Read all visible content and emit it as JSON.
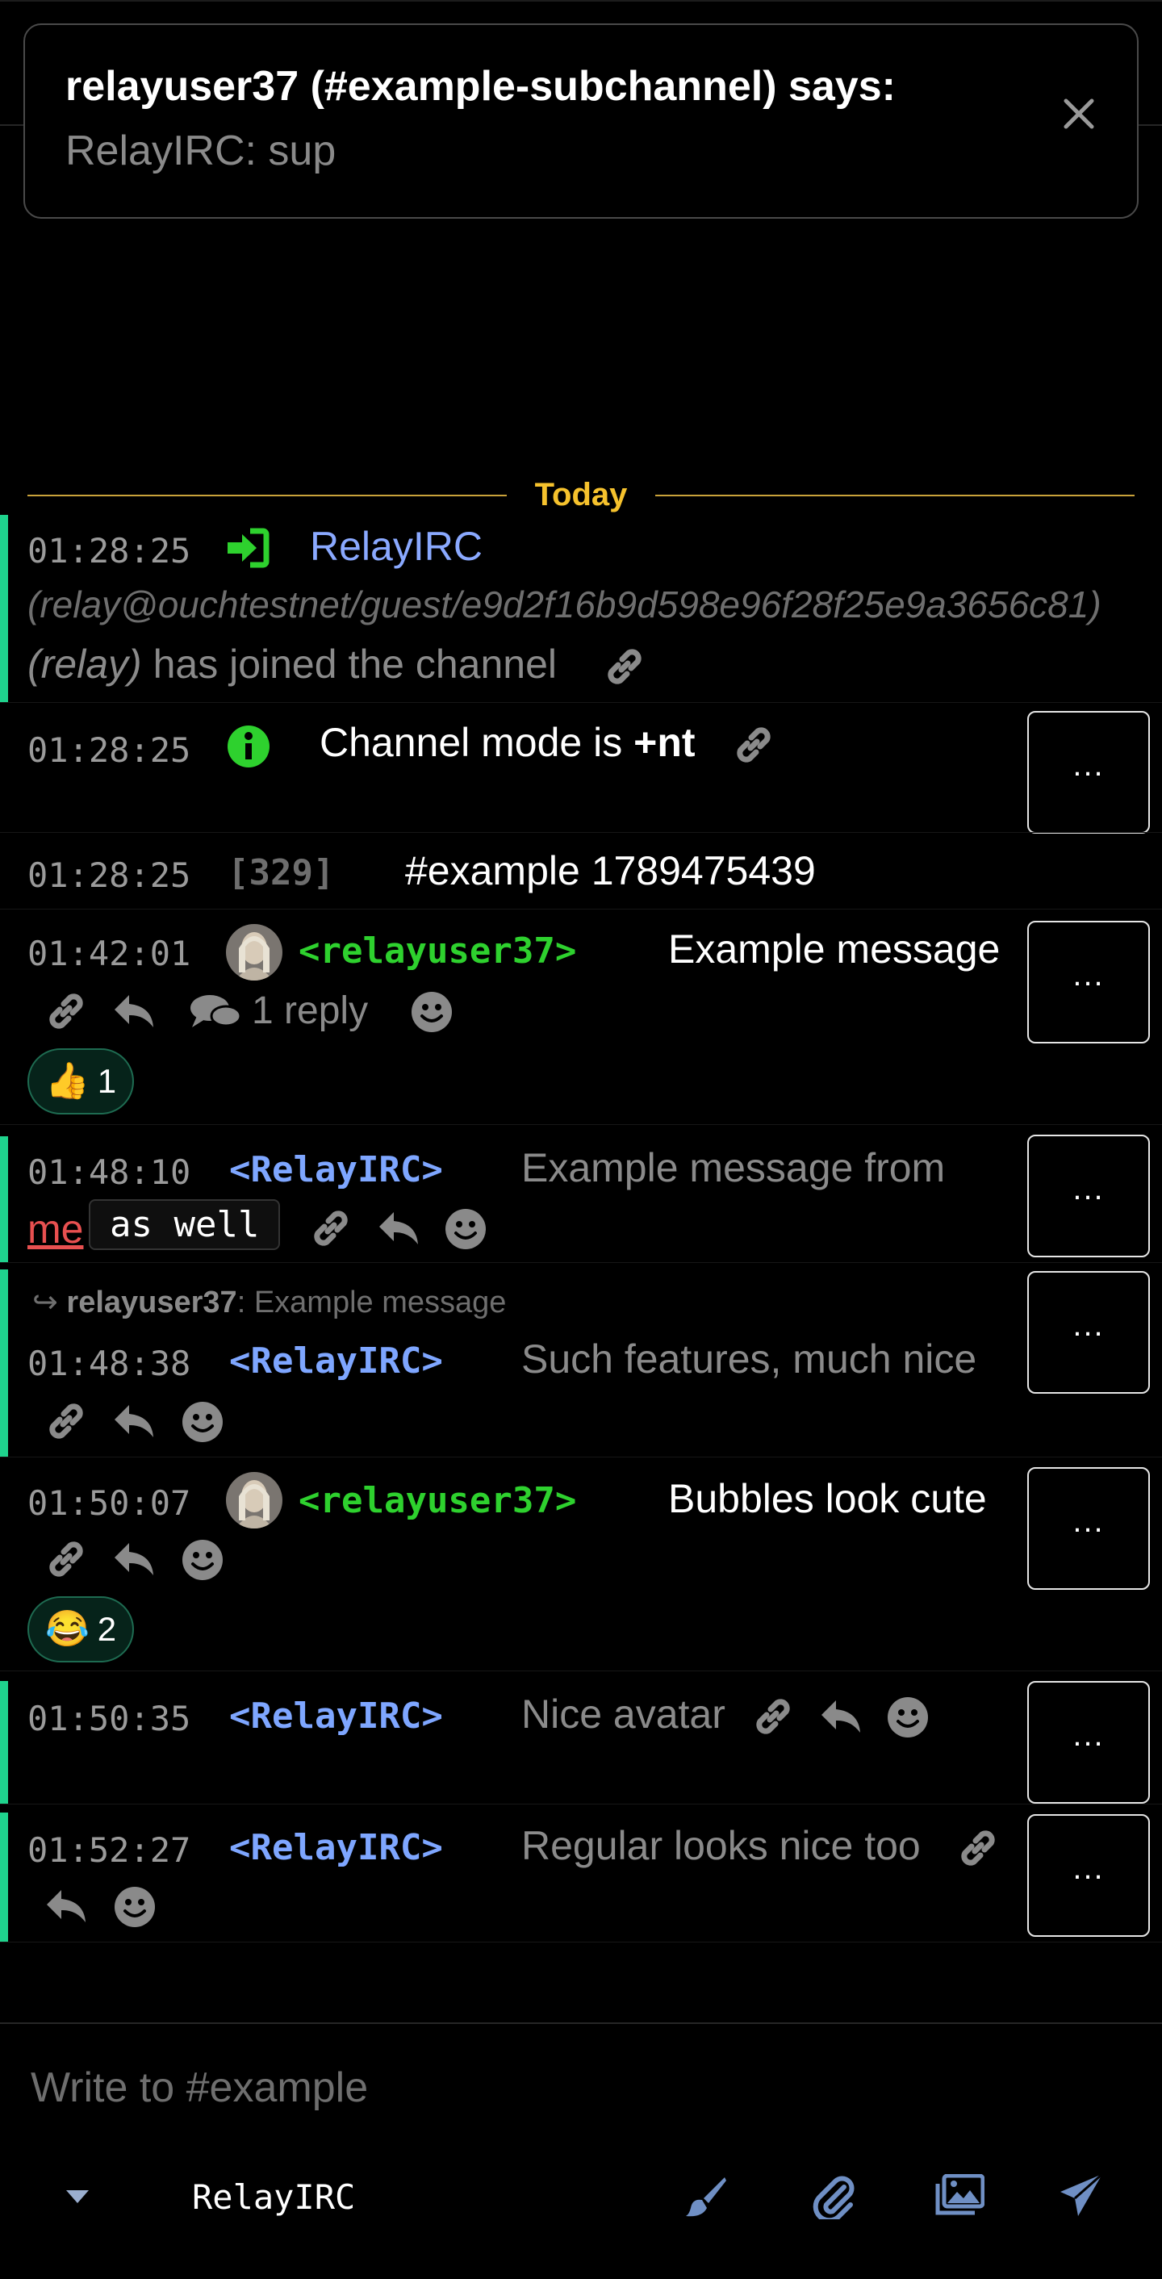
{
  "colors": {
    "background": "#000000",
    "accent_green": "#1fd38d",
    "nick_green": "#2ed12e",
    "nick_blue": "#7ea6ff",
    "day_separator": "#f6c22d",
    "mention_red": "#e85050"
  },
  "notification": {
    "title": "relayuser37 (#example-subchannel) says:",
    "body": "RelayIRC: sup",
    "close_icon": "close-icon"
  },
  "day_separator": {
    "label": "Today"
  },
  "messages": [
    {
      "time": "01:28:25",
      "icon": "join-icon",
      "nick": "RelayIRC",
      "hostmask": "(relay@ouchtestnet/guest/e9d2f16b9d598e96f28f25e9a3656c81)",
      "ident": "(relay)",
      "text": "has joined the channel"
    },
    {
      "time": "01:28:25",
      "icon": "info-icon",
      "text_prefix": "Channel mode is ",
      "mode": "+nt",
      "options_label": "..."
    },
    {
      "time": "01:28:25",
      "numeric": "[329]",
      "text": "#example 1789475439"
    },
    {
      "time": "01:42:01",
      "nick": "<relayuser37>",
      "text": "Example message",
      "reply_count": "1 reply",
      "reaction": {
        "emoji": "👍",
        "count": "1"
      },
      "options_label": "..."
    },
    {
      "time": "01:48:10",
      "nick": "<RelayIRC>",
      "text": "Example message from",
      "mention": "me",
      "code": "as well",
      "options_label": "..."
    },
    {
      "reply_to_nick": "relayuser37",
      "reply_to_text": ": Example message",
      "reply_arrow": "↪",
      "time": "01:48:38",
      "nick": "<RelayIRC>",
      "text": "Such features, much nice",
      "options_label": "..."
    },
    {
      "time": "01:50:07",
      "nick": "<relayuser37>",
      "text": "Bubbles look cute",
      "reaction": {
        "emoji": "😂",
        "count": "2"
      },
      "options_label": "..."
    },
    {
      "time": "01:50:35",
      "nick": "<RelayIRC>",
      "text": "Nice avatar",
      "options_label": "..."
    },
    {
      "time": "01:52:27",
      "nick": "<RelayIRC>",
      "text": "Regular looks nice too",
      "options_label": "..."
    }
  ],
  "composer": {
    "placeholder": "Write to #example",
    "nick": "RelayIRC",
    "icons": [
      "caret-down-icon",
      "brush-icon",
      "paperclip-icon",
      "images-icon",
      "send-icon"
    ]
  }
}
